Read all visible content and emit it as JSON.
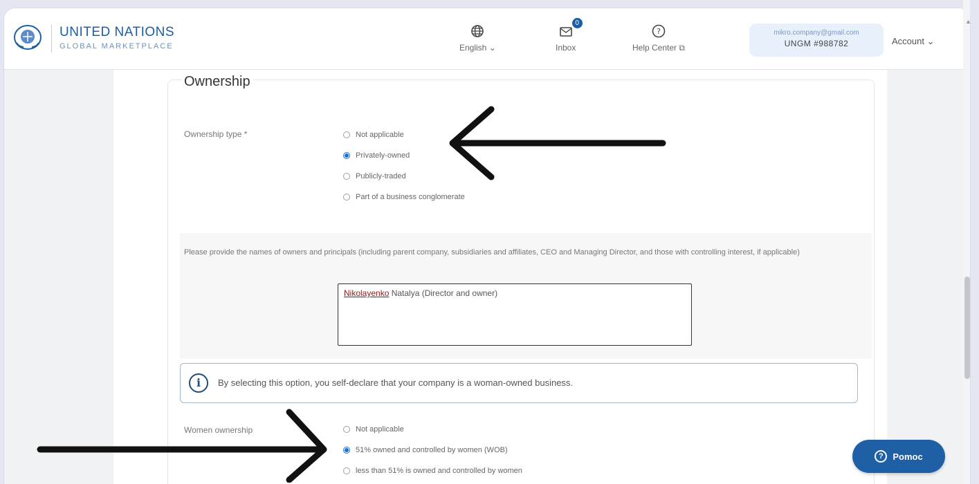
{
  "header": {
    "logo_title": "UNITED NATIONS",
    "logo_sub": "GLOBAL MARKETPLACE",
    "language_label": "English",
    "inbox_label": "Inbox",
    "inbox_count": "0",
    "help_label": "Help Center",
    "account_email": "mikro.company@gmail.com",
    "account_id": "UNGM #988782",
    "account_menu_label": "Account"
  },
  "ownership": {
    "title": "Ownership",
    "type_label": "Ownership type *",
    "type_options": [
      {
        "label": "Not applicable",
        "checked": false
      },
      {
        "label": "Privately-owned",
        "checked": true
      },
      {
        "label": "Publicly-traded",
        "checked": false
      },
      {
        "label": "Part of a business conglomerate",
        "checked": false
      }
    ],
    "owners_description": "Please provide the names of owners and principals (including parent company, subsidiaries and affiliates, CEO and Managing Director, and those with controlling interest, if applicable)",
    "owners_value_first": "Nikolayenko",
    "owners_value_rest": " Natalya (Director and owner)"
  },
  "info": {
    "text": "By selecting this option, you self-declare that your company is a woman-owned business."
  },
  "women_ownership": {
    "label": "Women ownership",
    "options": [
      {
        "label": "Not applicable",
        "checked": false
      },
      {
        "label": "51% owned and controlled by women (WOB)",
        "checked": true
      },
      {
        "label": "less than 51% is owned and controlled by women",
        "checked": false
      }
    ]
  },
  "help_button": {
    "label": "Pomoc"
  },
  "colors": {
    "brand_blue": "#1a5fa6",
    "radio_selected": "#1a6fd6",
    "annotation_arrow": "#111111"
  }
}
